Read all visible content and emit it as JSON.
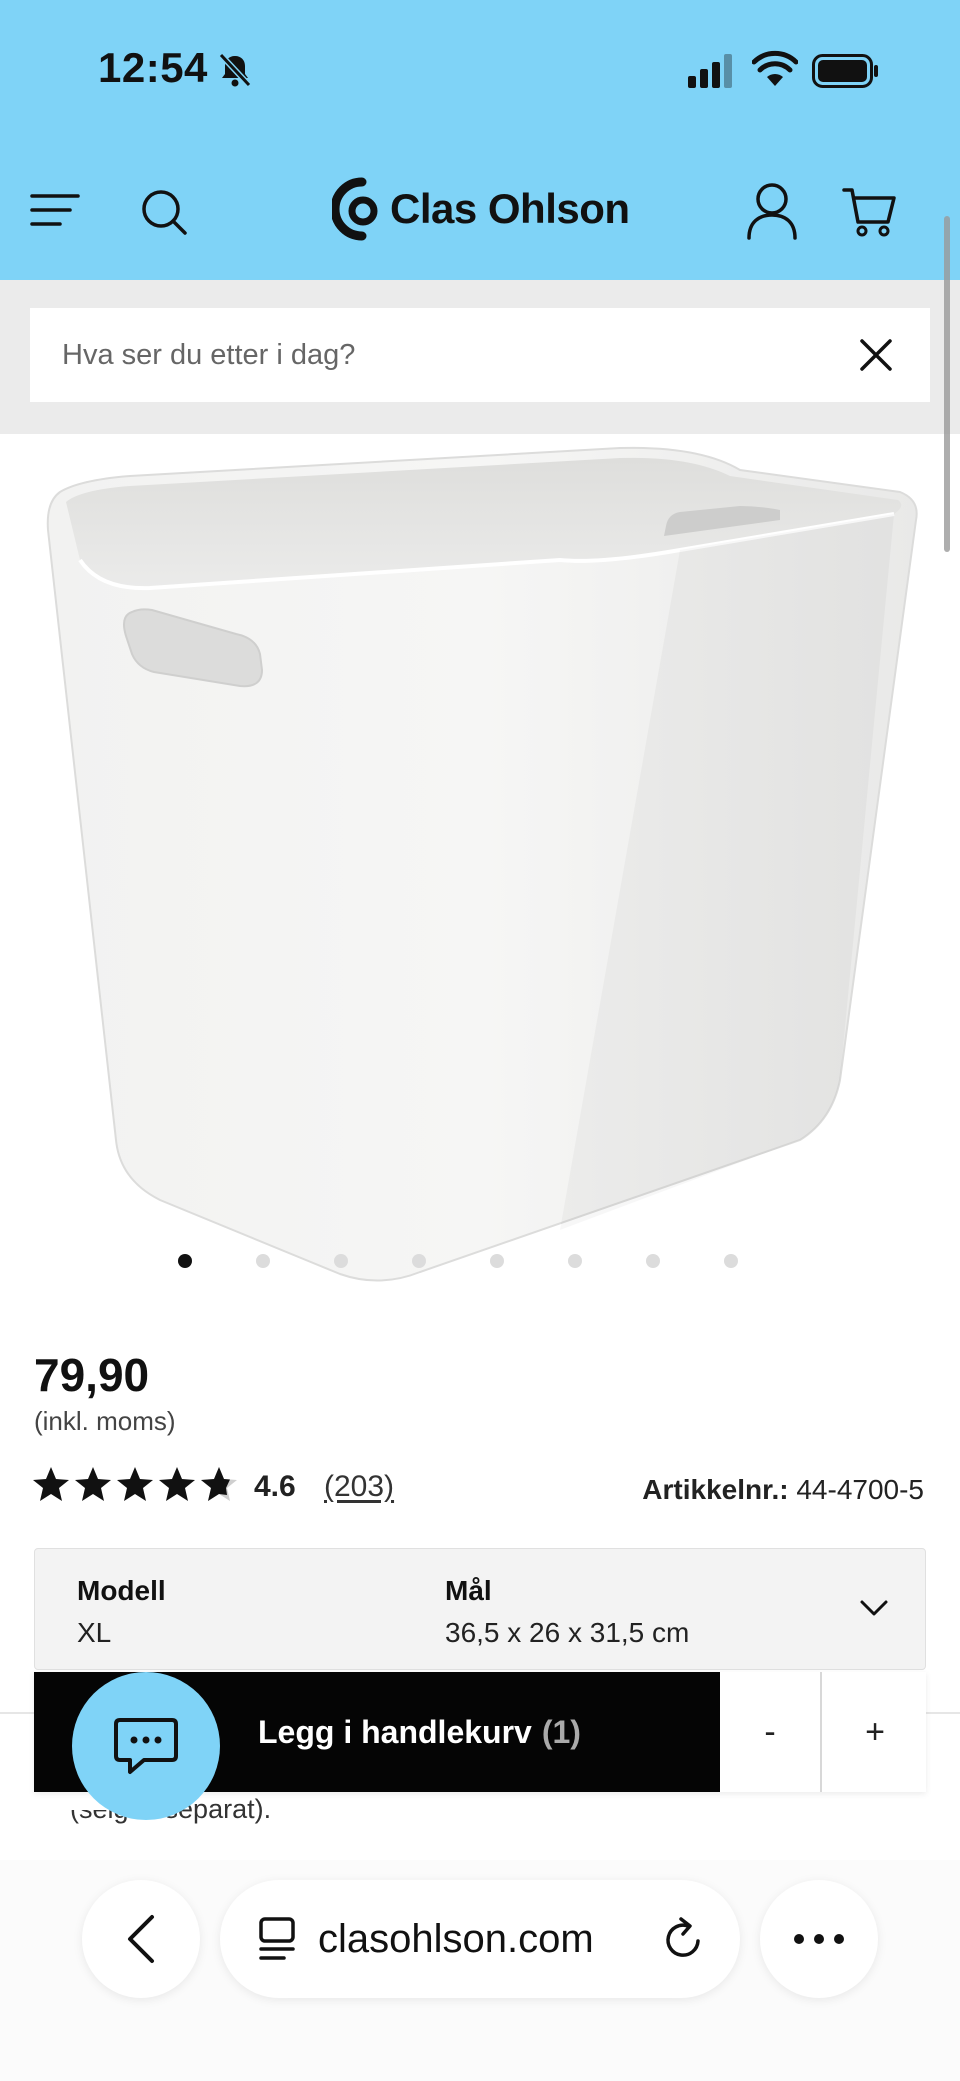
{
  "status_bar": {
    "time": "12:54"
  },
  "header": {
    "logo_text": "Clas Ohlson"
  },
  "search": {
    "placeholder": "Hva ser du etter i dag?"
  },
  "gallery": {
    "image_count": 8,
    "active_index": 0
  },
  "product": {
    "price": "79,90",
    "price_note": "(inkl. moms)",
    "rating": "4.6",
    "rating_out_of": 5,
    "review_count": "(203)",
    "article_label": "Artikkelnr.:",
    "article_number": "44-4700-5"
  },
  "variant": {
    "model_label": "Modell",
    "model_value": "XL",
    "size_label": "Mål",
    "size_value": "36,5 x 26 x 31,5 cm"
  },
  "cart_bar": {
    "add_label": "Legg i handlekurv",
    "quantity": "(1)",
    "minus": "-",
    "plus": "+"
  },
  "partial_text": "(selges separat).",
  "browser": {
    "url": "clasohlson.com"
  },
  "colors": {
    "brand_blue": "#7fd3f7",
    "black": "#050505"
  }
}
